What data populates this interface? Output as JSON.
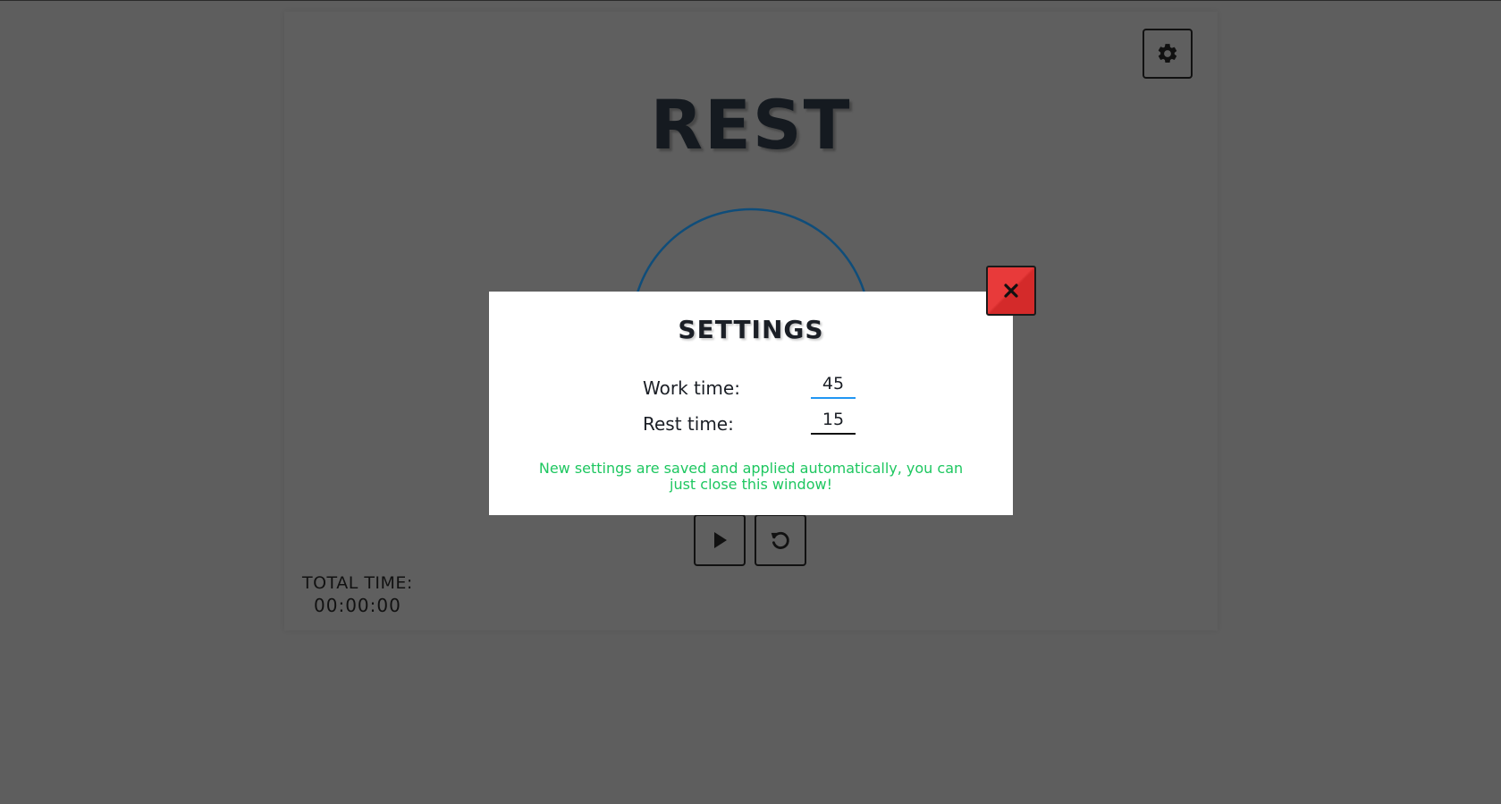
{
  "app": {
    "phase_title": "REST",
    "settings_icon": "gear-icon",
    "ring_color": "#0f4d7a",
    "controls": {
      "play_icon": "play-icon",
      "reset_icon": "reset-icon"
    },
    "total_time": {
      "label": "TOTAL TIME:",
      "value": "00:00:00"
    }
  },
  "modal": {
    "title": "SETTINGS",
    "close_icon": "close-icon",
    "close_color": "#e83a3a",
    "fields": [
      {
        "label": "Work time:",
        "value": "45"
      },
      {
        "label": "Rest time:",
        "value": "15"
      }
    ],
    "note": "New settings are saved and applied automatically, you can just close this window!",
    "note_color": "#1ec760"
  },
  "colors": {
    "overlay_background": "#5e5e5e",
    "text": "#151a20",
    "focus_accent": "#2196f3"
  }
}
